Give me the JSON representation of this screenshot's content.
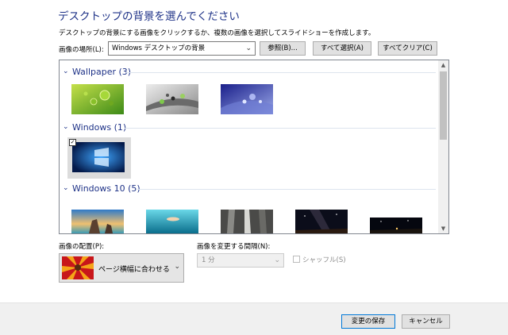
{
  "header": {
    "title": "デスクトップの背景を選んでください",
    "subtitle": "デスクトップの背景にする画像をクリックするか、複数の画像を選択してスライドショーを作成します。"
  },
  "location": {
    "label": "画像の場所(L):",
    "value": "Windows デスクトップの背景",
    "browse_label": "参照(B)...",
    "select_all_label": "すべて選択(A)",
    "clear_all_label": "すべてクリア(C)"
  },
  "groups": [
    {
      "name": "Wallpaper (3)"
    },
    {
      "name": "Windows (1)"
    },
    {
      "name": "Windows 10 (5)"
    }
  ],
  "thumbnails": {
    "wallpaper": [
      "green-bubbles-thumbnail",
      "silver-bubbles-thumbnail",
      "blue-bubbles-thumbnail"
    ],
    "windows": [
      "windows-hero-thumbnail"
    ],
    "windows10": [
      "beach-rocks-thumbnail",
      "underwater-swimmer-thumbnail",
      "waterfall-thumbnail",
      "night-sky-thumbnail",
      "starry-horizon-thumbnail"
    ],
    "selected_checkmark": "✓"
  },
  "position": {
    "label": "画像の配置(P):",
    "value": "ページ横幅に合わせる"
  },
  "interval": {
    "label": "画像を変更する間隔(N):",
    "value": "1 分"
  },
  "shuffle": {
    "label": "シャッフル(S)",
    "checked": false
  },
  "footer": {
    "save_label": "変更の保存",
    "cancel_label": "キャンセル"
  },
  "colors": {
    "title": "#1e3287",
    "group_header": "#1e3287",
    "primary_button_border": "#0078d7"
  }
}
